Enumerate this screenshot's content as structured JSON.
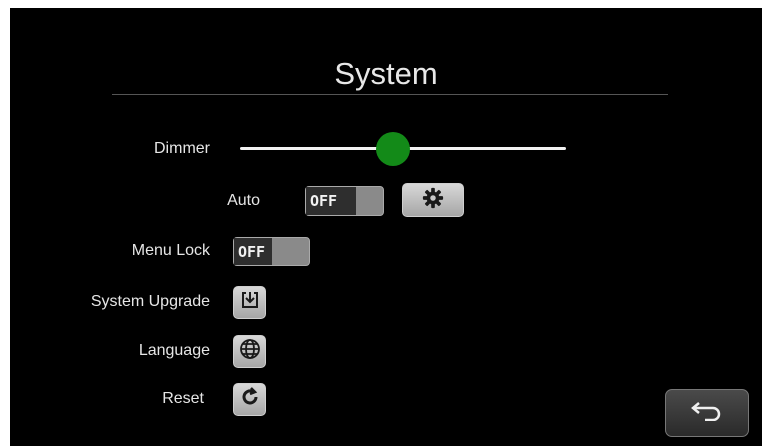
{
  "page_title": "System",
  "dimmer": {
    "label": "Dimmer",
    "level": 0.47
  },
  "auto": {
    "label": "Auto",
    "toggle_state": "OFF"
  },
  "menu_lock": {
    "label": "Menu Lock",
    "toggle_state": "OFF"
  },
  "system_upgrade": {
    "label": "System Upgrade"
  },
  "language": {
    "label": "Language"
  },
  "reset": {
    "label": "Reset"
  },
  "colors": {
    "background": "#000000",
    "accent_green": "#138a18",
    "button_gray": "#b8b8b8"
  },
  "icons": [
    "gear-icon",
    "download-icon",
    "globe-icon",
    "refresh-icon",
    "back-arrow-icon"
  ]
}
